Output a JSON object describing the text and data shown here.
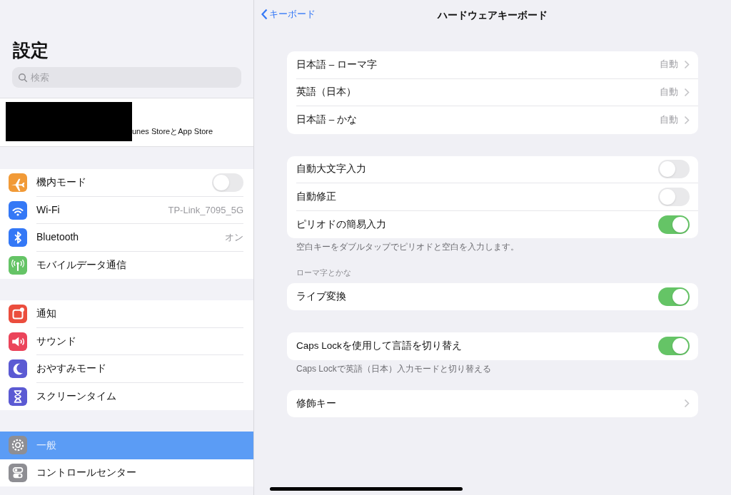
{
  "sidebar": {
    "title": "設定",
    "search": {
      "placeholder": "検索"
    },
    "account": {
      "subtitle": "unes StoreとApp Store"
    },
    "groups": [
      [
        {
          "label": "機内モード",
          "kind": "airplane",
          "color": "#f19a37",
          "toggle": {
            "on": false
          },
          "selected": false
        },
        {
          "label": "Wi-Fi",
          "kind": "wifi",
          "color": "#3478f6",
          "value": "TP-Link_7095_5G",
          "selected": false
        },
        {
          "label": "Bluetooth",
          "kind": "bluetooth",
          "color": "#3478f6",
          "value": "オン",
          "selected": false
        },
        {
          "label": "モバイルデータ通信",
          "kind": "cellular",
          "color": "#65c466",
          "selected": false
        }
      ],
      [
        {
          "label": "通知",
          "kind": "notifications",
          "color": "#eb4d3d",
          "selected": false
        },
        {
          "label": "サウンド",
          "kind": "sound",
          "color": "#eb445a",
          "selected": false
        },
        {
          "label": "おやすみモード",
          "kind": "moon",
          "color": "#5b5ad3",
          "selected": false
        },
        {
          "label": "スクリーンタイム",
          "kind": "hourglass",
          "color": "#5b5ad3",
          "selected": false
        }
      ],
      [
        {
          "label": "一般",
          "kind": "gear",
          "color": "#8e8e93",
          "selected": true
        },
        {
          "label": "コントロールセンター",
          "kind": "switches",
          "color": "#8e8e93",
          "selected": false
        }
      ]
    ]
  },
  "detail": {
    "back": "キーボード",
    "title": "ハードウェアキーボード",
    "sections": [
      {
        "rows": [
          {
            "kind": "link",
            "label": "日本語 – ローマ字",
            "value": "自動"
          },
          {
            "kind": "link",
            "label": "英語（日本）",
            "value": "自動"
          },
          {
            "kind": "link",
            "label": "日本語 – かな",
            "value": "自動"
          }
        ]
      },
      {
        "rows": [
          {
            "kind": "toggle",
            "label": "自動大文字入力",
            "on": false
          },
          {
            "kind": "toggle",
            "label": "自動修正",
            "on": false
          },
          {
            "kind": "toggle",
            "label": "ピリオドの簡易入力",
            "on": true
          }
        ],
        "footer": "空白キーをダブルタップでピリオドと空白を入力します。"
      },
      {
        "header": "ローマ字とかな",
        "rows": [
          {
            "kind": "toggle",
            "label": "ライブ変換",
            "on": true
          }
        ]
      },
      {
        "rows": [
          {
            "kind": "toggle",
            "label": "Caps Lockを使用して言語を切り替え",
            "on": true
          }
        ],
        "footer": "Caps Lockで英語（日本）入力モードと切り替える"
      },
      {
        "rows": [
          {
            "kind": "link",
            "label": "修飾キー"
          }
        ]
      }
    ]
  }
}
